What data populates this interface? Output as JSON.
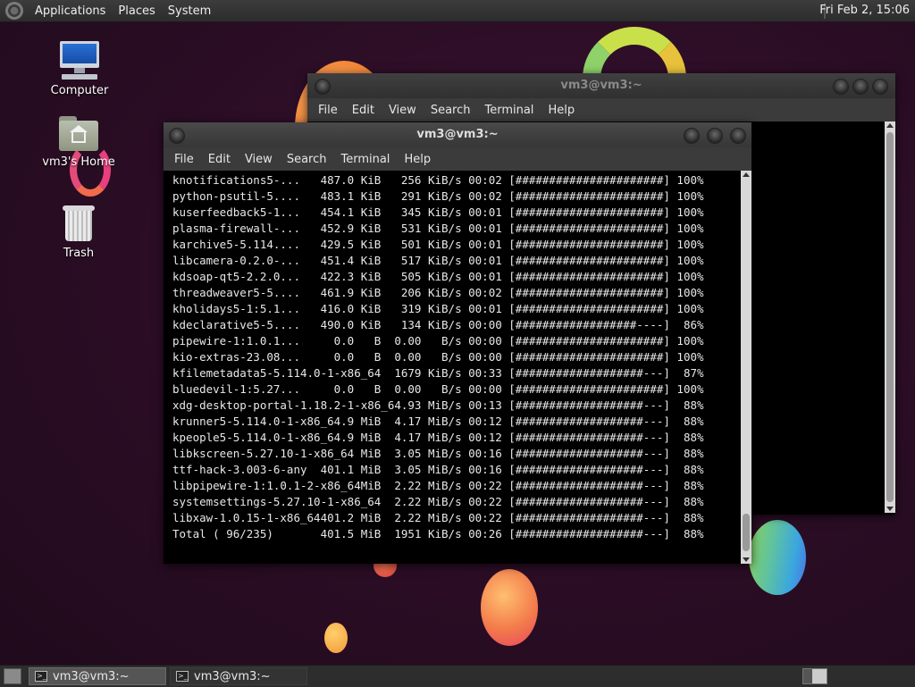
{
  "top_panel": {
    "menus": [
      "Applications",
      "Places",
      "System"
    ],
    "clock": "Fri Feb  2, 15:06"
  },
  "desktop_icons": [
    {
      "label": "Computer",
      "icon": "computer-icon"
    },
    {
      "label": "vm3's Home",
      "icon": "home-folder-icon"
    },
    {
      "label": "Trash",
      "icon": "trash-icon"
    }
  ],
  "back_window": {
    "title": "vm3@vm3:~",
    "menus": [
      "File",
      "Edit",
      "View",
      "Search",
      "Terminal",
      "Help"
    ]
  },
  "front_window": {
    "title": "vm3@vm3:~",
    "menus": [
      "File",
      "Edit",
      "View",
      "Search",
      "Terminal",
      "Help"
    ],
    "lines": [
      "knotifications5-...   487.0 KiB   256 KiB/s 00:02 [######################] 100%",
      "python-psutil-5....   483.1 KiB   291 KiB/s 00:02 [######################] 100%",
      "kuserfeedback5-1...   454.1 KiB   345 KiB/s 00:01 [######################] 100%",
      "plasma-firewall-...   452.9 KiB   531 KiB/s 00:01 [######################] 100%",
      "karchive5-5.114....   429.5 KiB   501 KiB/s 00:01 [######################] 100%",
      "libcamera-0.2.0-...   451.4 KiB   517 KiB/s 00:01 [######################] 100%",
      "kdsoap-qt5-2.2.0...   422.3 KiB   505 KiB/s 00:01 [######################] 100%",
      "threadweaver5-5....   461.9 KiB   206 KiB/s 00:02 [######################] 100%",
      "kholidays5-1:5.1...   416.0 KiB   319 KiB/s 00:01 [######################] 100%",
      "kdeclarative5-5....   490.0 KiB   134 KiB/s 00:00 [##################----]  86%",
      "pipewire-1:1.0.1...     0.0   B  0.00   B/s 00:00 [######################] 100%",
      "kio-extras-23.08...     0.0   B  0.00   B/s 00:00 [######################] 100%",
      "kfilemetadata5-5.114.0-1-x86_64  1679 KiB/s 00:33 [###################---]  87%",
      "bluedevil-1:5.27...     0.0   B  0.00   B/s 00:00 [######################] 100%",
      "xdg-desktop-portal-1.18.2-1-x86_64.93 MiB/s 00:13 [###################---]  88%",
      "krunner5-5.114.0-1-x86_64.9 MiB  4.17 MiB/s 00:12 [###################---]  88%",
      "kpeople5-5.114.0-1-x86_64.9 MiB  4.17 MiB/s 00:12 [###################---]  88%",
      "libkscreen-5.27.10-1-x86_64 MiB  3.05 MiB/s 00:16 [###################---]  88%",
      "ttf-hack-3.003-6-any  401.1 MiB  3.05 MiB/s 00:16 [###################---]  88%",
      "libpipewire-1:1.0.1-2-x86_64MiB  2.22 MiB/s 00:22 [###################---]  88%",
      "systemsettings-5.27.10-1-x86_64  2.22 MiB/s 00:22 [###################---]  88%",
      "libxaw-1.0.15-1-x86_64401.2 MiB  2.22 MiB/s 00:22 [###################---]  88%",
      "Total ( 96/235)       401.5 MiB  1951 KiB/s 00:26 [###################---]  88%"
    ]
  },
  "taskbar": {
    "tasks": [
      {
        "label": "vm3@vm3:~",
        "active": true
      },
      {
        "label": "vm3@vm3:~",
        "active": false
      }
    ]
  }
}
